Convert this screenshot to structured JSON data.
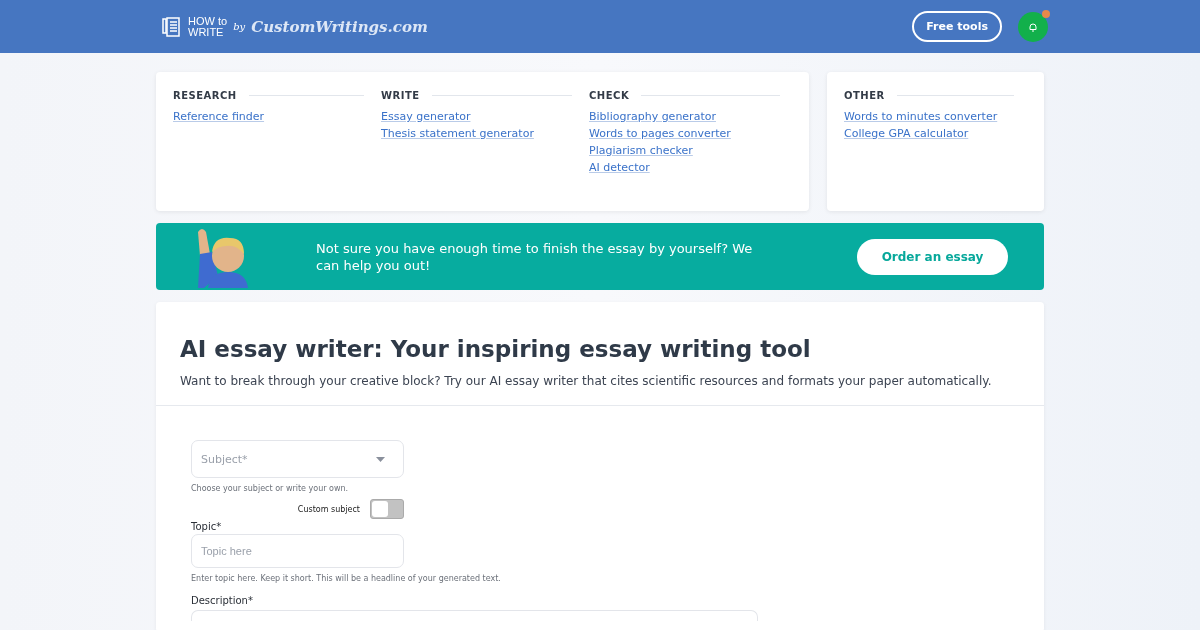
{
  "header": {
    "logo": {
      "mark_top": "HOW to",
      "mark_bottom": "WRITE",
      "by": "by",
      "brand": "CustomWritings.com"
    },
    "free_tools": "Free tools",
    "notification_dot": true
  },
  "menu": [
    {
      "heading": "RESEARCH",
      "links": [
        "Reference finder"
      ]
    },
    {
      "heading": "WRITE",
      "links": [
        "Essay generator",
        "Thesis statement generator"
      ]
    },
    {
      "heading": "CHECK",
      "links": [
        "Bibliography generator",
        "Words to pages converter",
        "Plagiarism checker",
        "AI detector"
      ]
    }
  ],
  "other": {
    "heading": "OTHER",
    "links": [
      "Words to minutes converter",
      "College GPA calculator"
    ]
  },
  "banner": {
    "text": "Not sure you have enough time to finish the essay by yourself? We can help you out!",
    "button": "Order an essay"
  },
  "main": {
    "title": "AI essay writer: Your inspiring essay writing tool",
    "subtitle": "Want to break through your creative block? Try our AI essay writer that cites scientific resources and formats your paper automatically.",
    "subject": {
      "placeholder": "Subject*",
      "hint": "Choose your subject or write your own."
    },
    "custom_subject": {
      "label": "Custom subject",
      "on": false
    },
    "topic": {
      "label": "Topic*",
      "placeholder": "Topic here",
      "hint": "Enter topic here. Keep it short. This will be a headline of your generated text."
    },
    "description": {
      "label": "Description*"
    }
  }
}
